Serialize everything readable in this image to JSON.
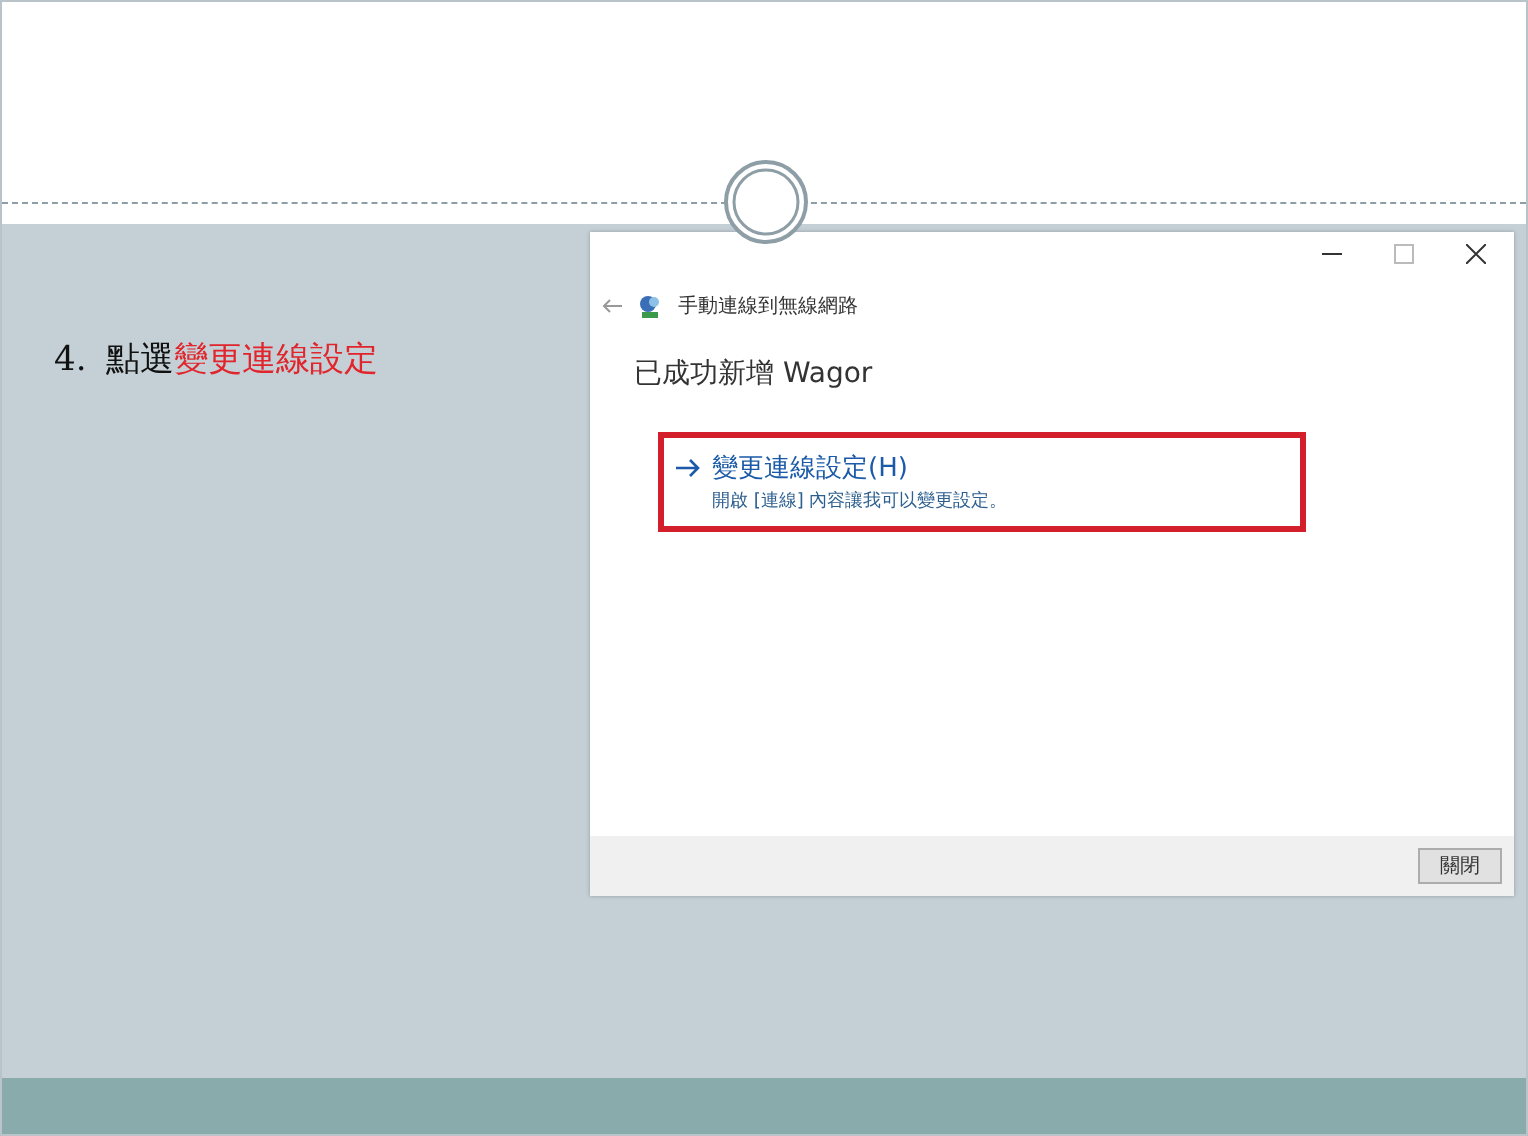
{
  "step": {
    "number": "4.",
    "text": "點選",
    "highlight": "變更連線設定"
  },
  "dialog": {
    "title": "手動連線到無線網路",
    "heading": "已成功新增 Wagor",
    "option": {
      "label": "變更連線設定(H)",
      "description": "開啟 [連線] 內容讓我可以變更設定。",
      "highlighted": true
    },
    "button": "關閉"
  }
}
